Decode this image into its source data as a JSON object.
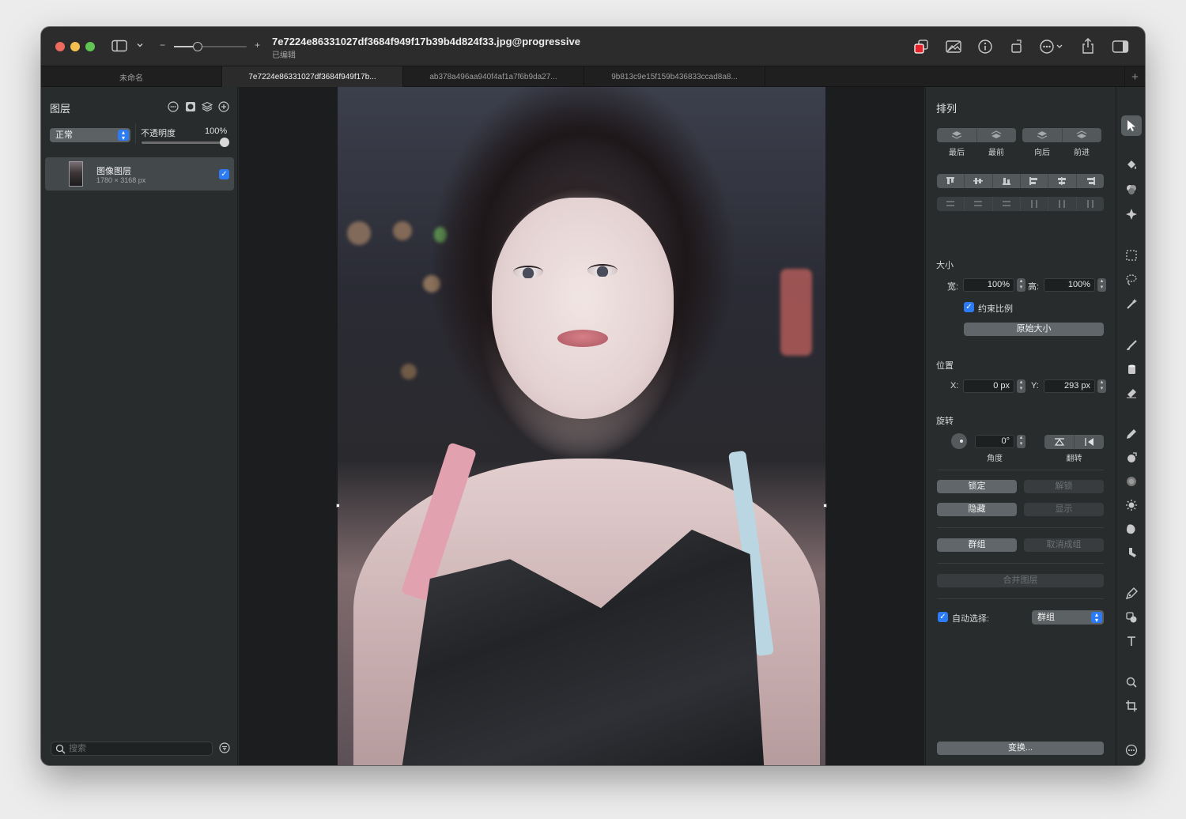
{
  "window": {
    "title": "7e7224e86331027df3684f949f17b39b4d824f33.jpg@progressive",
    "subtitle": "已编辑",
    "zoom_minus": "−",
    "zoom_plus": "+",
    "zoom_level": 0.3
  },
  "tabs": [
    {
      "label": "未命名",
      "active": false
    },
    {
      "label": "7e7224e86331027df3684f949f17b...",
      "active": true
    },
    {
      "label": "ab378a496aa940f4af1a7f6b9da27...",
      "active": false
    },
    {
      "label": "9b813c9e15f159b436833ccad8a8...",
      "active": false
    }
  ],
  "tab_add": "+",
  "layers_panel": {
    "title": "图层",
    "blend_mode": "正常",
    "opacity_label": "不透明度",
    "opacity_value": "100%",
    "opacity_fraction": 1.0,
    "layer": {
      "name": "图像图层",
      "dimensions": "1780 × 3168 px",
      "visible": true
    },
    "search_placeholder": "搜索"
  },
  "arrange_panel": {
    "title": "排列",
    "order_labels": [
      "最后",
      "最前",
      "向后",
      "前进"
    ],
    "size_label": "大小",
    "width_label": "宽:",
    "width_value": "100%",
    "height_label": "高:",
    "height_value": "100%",
    "constrain_label": "约束比例",
    "constrain_checked": true,
    "original_size_button": "原始大小",
    "position_label": "位置",
    "x_label": "X:",
    "x_value": "0 px",
    "y_label": "Y:",
    "y_value": "293 px",
    "rotate_label": "旋转",
    "angle_value": "0°",
    "angle_caption": "角度",
    "flip_caption": "翻转",
    "lock_button": "锁定",
    "unlock_button": "解锁",
    "hide_button": "隐藏",
    "show_button": "显示",
    "group_button": "群组",
    "ungroup_button": "取消成组",
    "merge_button": "合并图层",
    "auto_select_label": "自动选择:",
    "auto_select_checked": true,
    "auto_select_value": "群组",
    "transform_button": "变换..."
  },
  "tools": [
    "pointer-icon",
    "paint-bucket-icon",
    "color-adjust-icon",
    "magic-star-icon",
    "marquee-select-icon",
    "lasso-icon",
    "magic-wand-icon",
    "brush-icon",
    "fill-icon",
    "eraser-icon",
    "pencil-icon",
    "clone-icon",
    "blur-icon",
    "sun-icon",
    "smudge-icon",
    "retouch-icon",
    "pen-icon",
    "shapes-icon",
    "text-icon",
    "zoom-icon",
    "crop-icon",
    "more-icon"
  ],
  "colors": {
    "accent": "#2d7bf4",
    "window_bg": "#262a2b",
    "canvas_bg": "#1b1d1e"
  }
}
